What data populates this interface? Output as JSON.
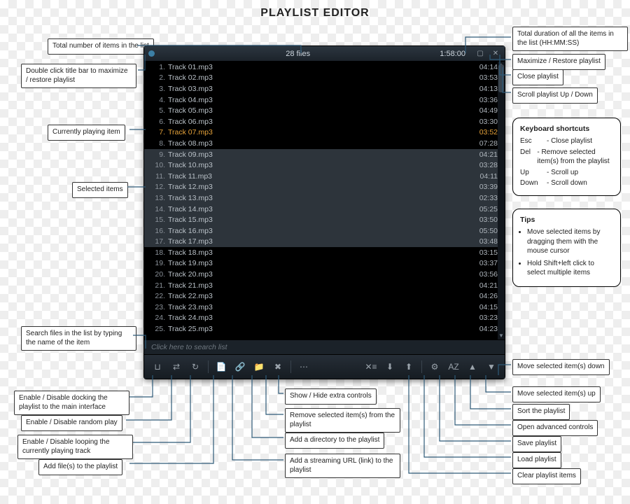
{
  "page_title": "PLAYLIST EDITOR",
  "window": {
    "file_count_label": "28 files",
    "total_duration": "1:58:00",
    "search_placeholder": "Click here to search list"
  },
  "tracks": [
    {
      "n": 1,
      "name": "Track 01.mp3",
      "dur": "04:14"
    },
    {
      "n": 2,
      "name": "Track 02.mp3",
      "dur": "03:53"
    },
    {
      "n": 3,
      "name": "Track 03.mp3",
      "dur": "04:13"
    },
    {
      "n": 4,
      "name": "Track 04.mp3",
      "dur": "03:36"
    },
    {
      "n": 5,
      "name": "Track 05.mp3",
      "dur": "04:49"
    },
    {
      "n": 6,
      "name": "Track 06.mp3",
      "dur": "03:30"
    },
    {
      "n": 7,
      "name": "Track 07.mp3",
      "dur": "03:52",
      "playing": true
    },
    {
      "n": 8,
      "name": "Track 08.mp3",
      "dur": "07:28"
    },
    {
      "n": 9,
      "name": "Track 09.mp3",
      "dur": "04:21",
      "selected": true
    },
    {
      "n": 10,
      "name": "Track 10.mp3",
      "dur": "03:28",
      "selected": true
    },
    {
      "n": 11,
      "name": "Track 11.mp3",
      "dur": "04:11",
      "selected": true
    },
    {
      "n": 12,
      "name": "Track 12.mp3",
      "dur": "03:39",
      "selected": true
    },
    {
      "n": 13,
      "name": "Track 13.mp3",
      "dur": "02:33",
      "selected": true
    },
    {
      "n": 14,
      "name": "Track 14.mp3",
      "dur": "05:25",
      "selected": true
    },
    {
      "n": 15,
      "name": "Track 15.mp3",
      "dur": "03:50",
      "selected": true
    },
    {
      "n": 16,
      "name": "Track 16.mp3",
      "dur": "05:50",
      "selected": true
    },
    {
      "n": 17,
      "name": "Track 17.mp3",
      "dur": "03:48",
      "selected": true
    },
    {
      "n": 18,
      "name": "Track 18.mp3",
      "dur": "03:15"
    },
    {
      "n": 19,
      "name": "Track 19.mp3",
      "dur": "03:37"
    },
    {
      "n": 20,
      "name": "Track 20.mp3",
      "dur": "03:56"
    },
    {
      "n": 21,
      "name": "Track 21.mp3",
      "dur": "04:21"
    },
    {
      "n": 22,
      "name": "Track 22.mp3",
      "dur": "04:26"
    },
    {
      "n": 23,
      "name": "Track 23.mp3",
      "dur": "04:15"
    },
    {
      "n": 24,
      "name": "Track 24.mp3",
      "dur": "03:23"
    },
    {
      "n": 25,
      "name": "Track 25.mp3",
      "dur": "04:23"
    }
  ],
  "annotations": {
    "total_items": "Total number of items in the list",
    "dbl_titlebar": "Double click title bar to maximize / restore playlist",
    "currently_playing": "Currently playing item",
    "selected_items": "Selected items",
    "search_hint": "Search files in the list by typing the name of the item",
    "docking": "Enable / Disable docking the playlist to the main interface",
    "random": "Enable / Disable random play",
    "loop": "Enable / Disable looping the currently playing track",
    "add_files": "Add file(s) to the playlist",
    "add_url": "Add a streaming URL (link) to the playlist",
    "add_dir": "Add a directory to the playlist",
    "remove_sel": "Remove selected item(s) from the playlist",
    "show_extra": "Show / Hide extra controls",
    "total_duration": "Total duration of all the items in the list (HH:MM:SS)",
    "maximize": "Maximize / Restore playlist",
    "close": "Close playlist",
    "scroll": "Scroll playlist Up / Down",
    "move_down": "Move selected item(s) down",
    "move_up": "Move selected item(s) up",
    "sort": "Sort the playlist",
    "open_adv": "Open advanced controls",
    "save": "Save playlist",
    "load": "Load playlist",
    "clear": "Clear playlist items"
  },
  "shortcuts": {
    "title": "Keyboard shortcuts",
    "rows": [
      {
        "key": "Esc",
        "desc": "Close playlist"
      },
      {
        "key": "Del",
        "desc": "Remove selected item(s) from the playlist"
      },
      {
        "key": "Up",
        "desc": "Scroll up"
      },
      {
        "key": "Down",
        "desc": "Scroll down"
      }
    ]
  },
  "tips": {
    "title": "Tips",
    "items": [
      "Move selected items by dragging them with the mouse cursor",
      "Hold Shift+left click to select multiple items"
    ]
  },
  "toolbar_icons": {
    "dock": "⊔",
    "shuffle": "⇄",
    "loop": "↻",
    "add_file": "📄",
    "add_url": "🔗",
    "add_dir": "📁",
    "remove": "✖",
    "extra": "⋯",
    "clear": "✕≡",
    "load": "⬇",
    "save": "⬆",
    "adv": "⚙",
    "sort": "AZ",
    "up": "▲",
    "down": "▼"
  }
}
